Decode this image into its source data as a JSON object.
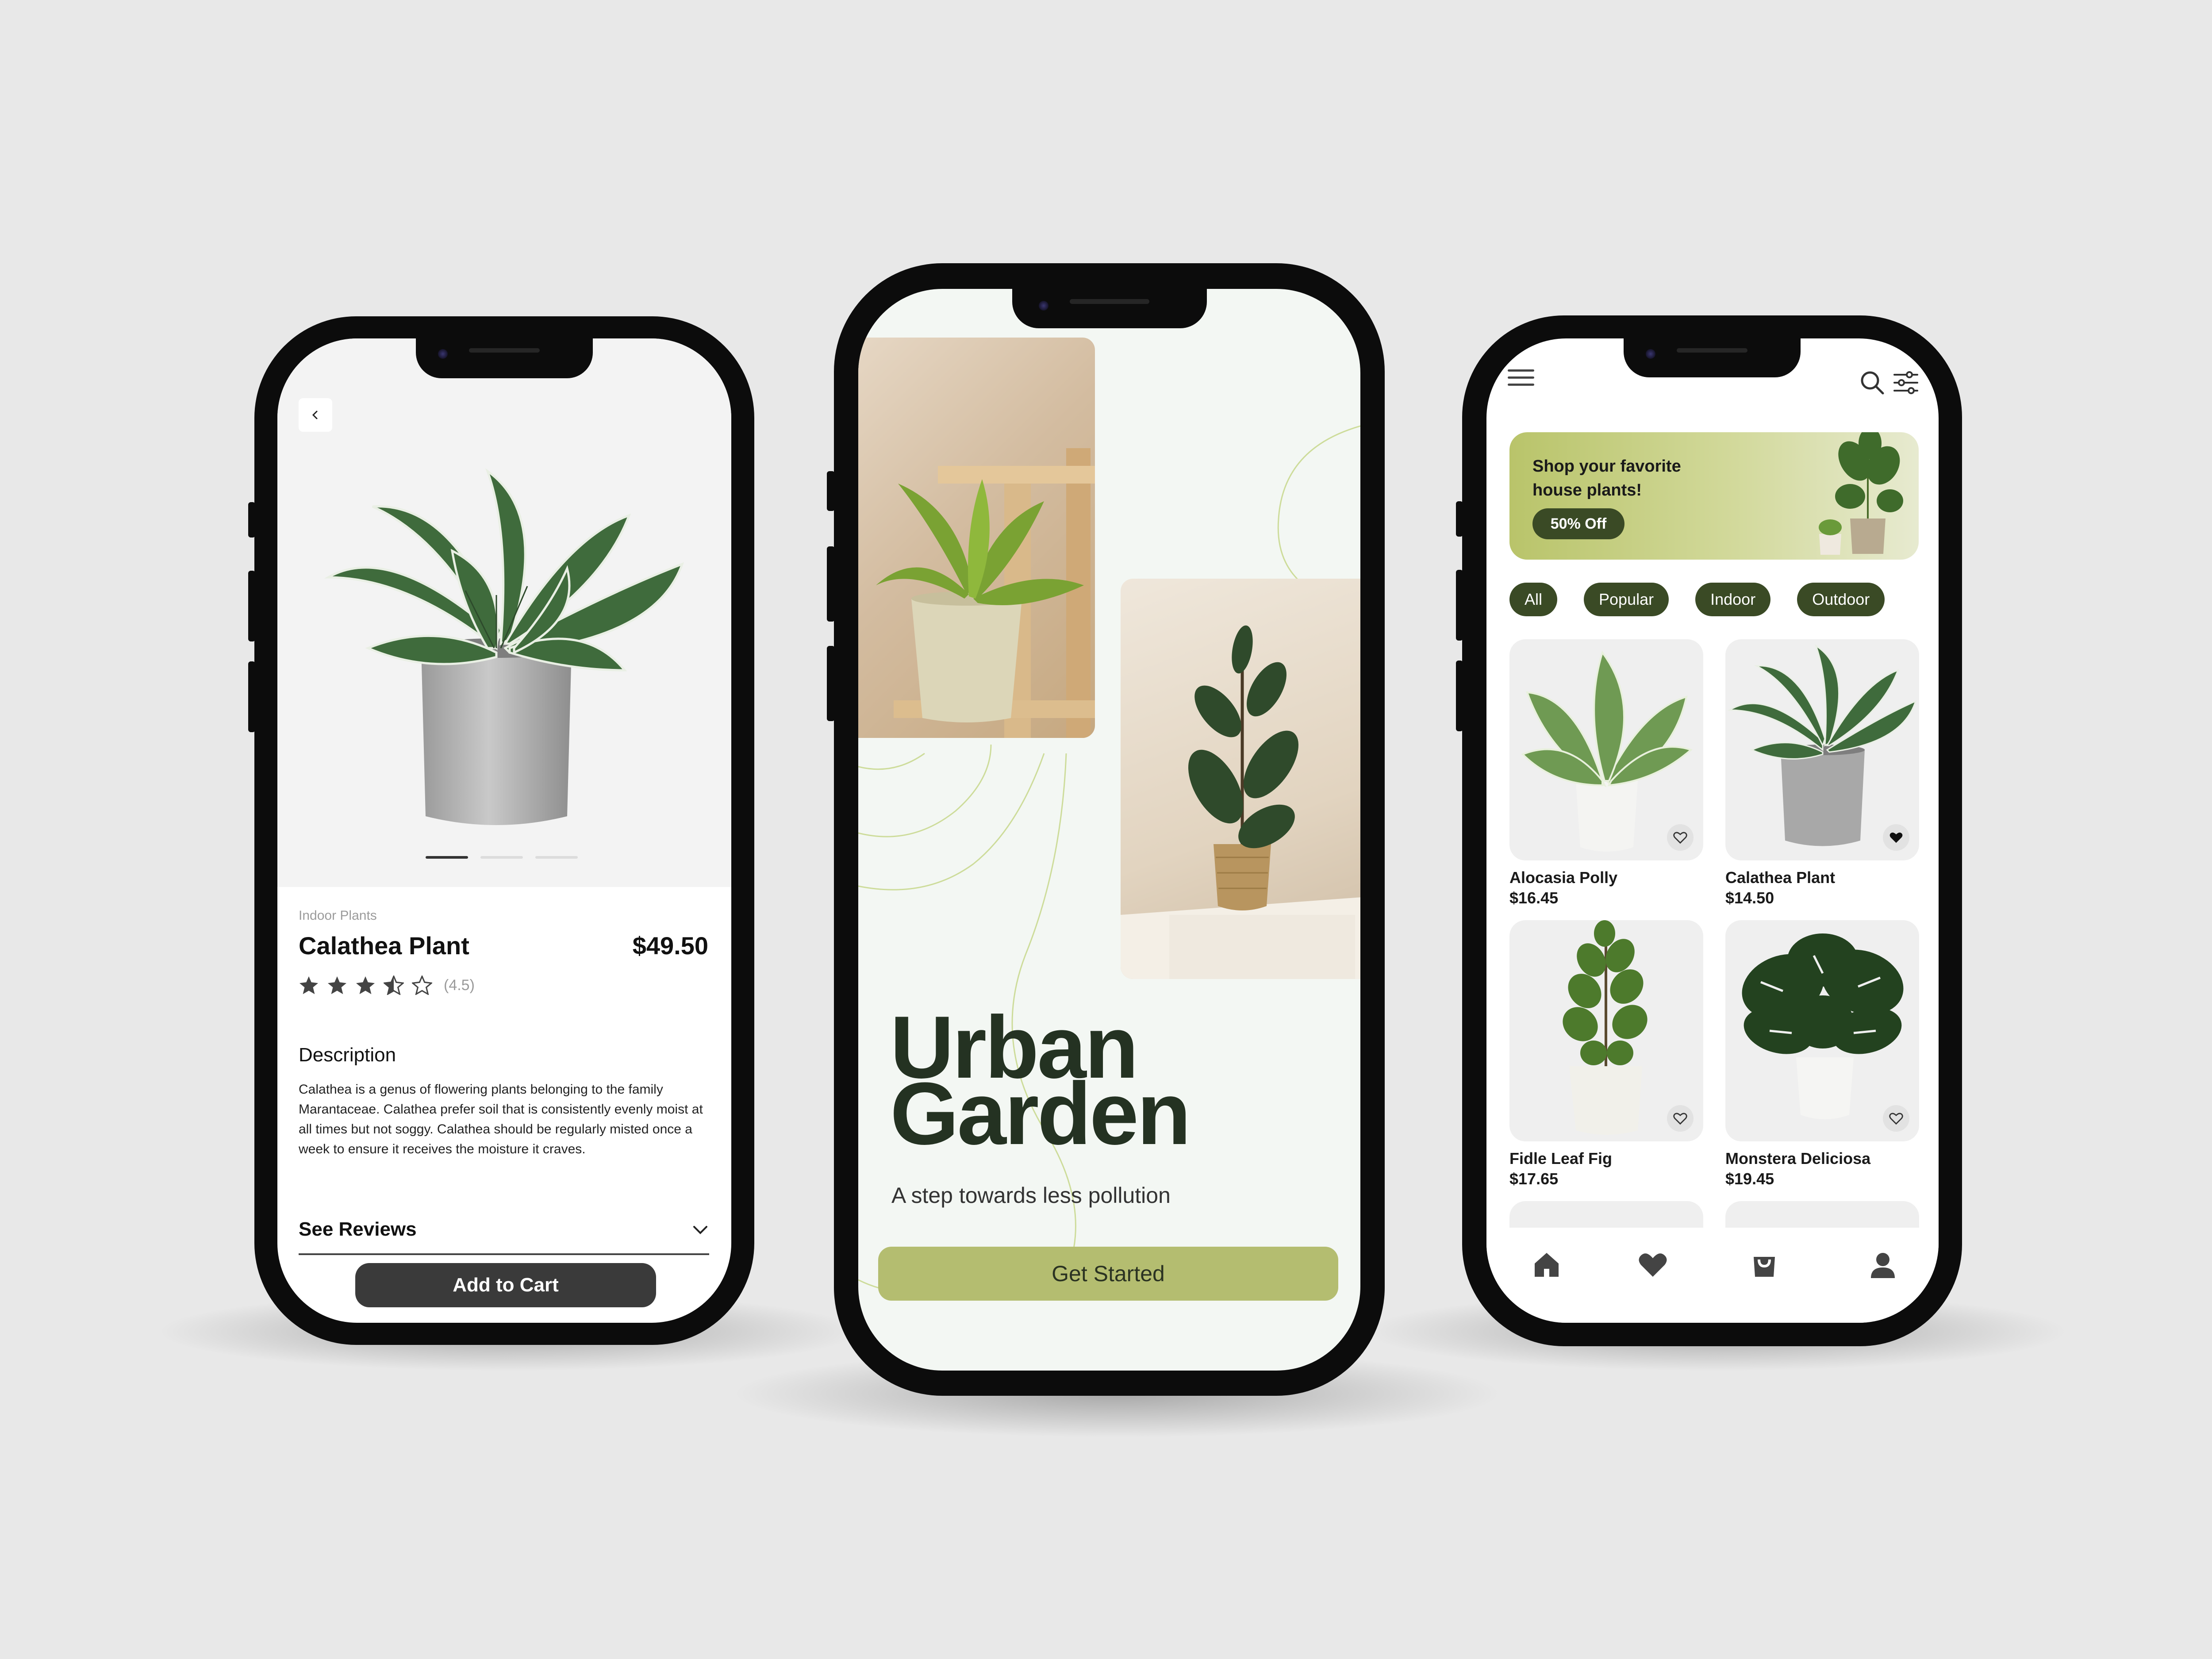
{
  "colors": {
    "background": "#e8e8e8",
    "dark_green": "#243222",
    "chip_green": "#3a4a25",
    "accent_olive": "#b4bd70",
    "button_dark": "#3a3a3a"
  },
  "detail_screen": {
    "back_icon": "chevron-left-icon",
    "category": "Indoor Plants",
    "title": "Calathea Plant",
    "price": "$49.50",
    "rating_stars": 4.5,
    "rating_text": "(4.5)",
    "carousel_index": 1,
    "carousel_count": 3,
    "description_heading": "Description",
    "description": "Calathea is a genus of flowering plants belonging to the family Marantaceae. Calathea prefer soil that is consistently evenly moist at all times but not soggy. Calathea should be regularly misted once a week to ensure it receives the moisture it craves.",
    "reviews_label": "See Reviews",
    "add_to_cart": "Add to Cart"
  },
  "landing_screen": {
    "title_line1": "Urban",
    "title_line2": "Garden",
    "subtitle": "A step towards less pollution",
    "cta": "Get Started"
  },
  "shop_screen": {
    "menu_icon": "hamburger-menu-icon",
    "search_icon": "search-icon",
    "filter_icon": "filter-sliders-icon",
    "banner": {
      "line1": "Shop your favorite",
      "line2": "house plants!",
      "badge": "50% Off"
    },
    "chips": [
      "All",
      "Popular",
      "Indoor",
      "Outdoor"
    ],
    "products": [
      {
        "name": "Alocasia Polly",
        "price": "$16.45",
        "favorited": false
      },
      {
        "name": "Calathea Plant",
        "price": "$14.50",
        "favorited": true
      },
      {
        "name": "Fidle Leaf Fig",
        "price": "$17.65",
        "favorited": false
      },
      {
        "name": "Monstera Deliciosa",
        "price": "$19.45",
        "favorited": false
      }
    ],
    "tabs": [
      "home-icon",
      "heart-icon",
      "shopping-bag-icon",
      "profile-icon"
    ]
  }
}
